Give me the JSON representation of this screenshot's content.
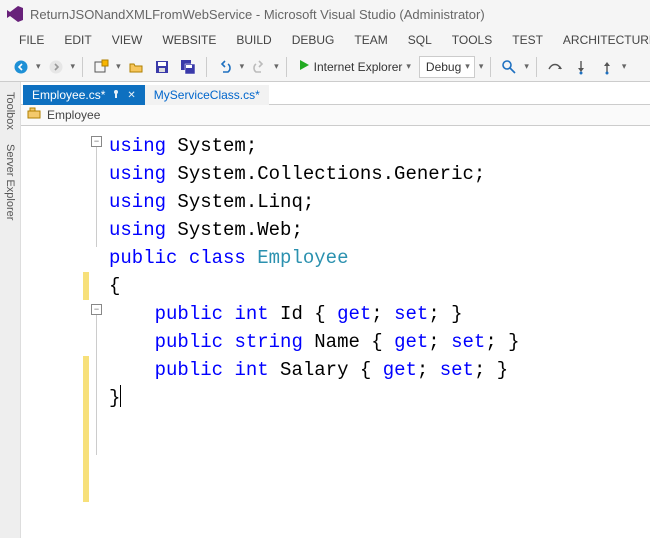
{
  "titlebar": {
    "title": "ReturnJSONandXMLFromWebService - Microsoft Visual Studio (Administrator)"
  },
  "menu": [
    "FILE",
    "EDIT",
    "VIEW",
    "WEBSITE",
    "BUILD",
    "DEBUG",
    "TEAM",
    "SQL",
    "TOOLS",
    "TEST",
    "ARCHITECTURE"
  ],
  "toolbar": {
    "browser": "Internet Explorer",
    "config": "Debug"
  },
  "side_tabs": {
    "toolbox": "Toolbox",
    "server_explorer": "Server Explorer"
  },
  "tabs": [
    {
      "label": "Employee.cs*",
      "active": true
    },
    {
      "label": "MyServiceClass.cs*",
      "active": false
    }
  ],
  "navbar": {
    "type_dropdown": "Employee"
  },
  "code": {
    "lines": [
      {
        "tokens": [
          [
            "kw",
            "using"
          ],
          [
            "pln",
            " "
          ],
          [
            "pln",
            "System;"
          ]
        ]
      },
      {
        "tokens": [
          [
            "kw",
            "using"
          ],
          [
            "pln",
            " "
          ],
          [
            "pln",
            "System.Collections.Generic;"
          ]
        ]
      },
      {
        "tokens": [
          [
            "kw",
            "using"
          ],
          [
            "pln",
            " "
          ],
          [
            "pln",
            "System.Linq;"
          ]
        ]
      },
      {
        "tokens": [
          [
            "kw",
            "using"
          ],
          [
            "pln",
            " "
          ],
          [
            "pln",
            "System.Web;"
          ]
        ]
      },
      {
        "tokens": [
          [
            "pln",
            ""
          ]
        ]
      },
      {
        "tokens": [
          [
            "pln",
            ""
          ]
        ]
      },
      {
        "tokens": [
          [
            "kw",
            "public"
          ],
          [
            "pln",
            " "
          ],
          [
            "kw",
            "class"
          ],
          [
            "pln",
            " "
          ],
          [
            "typ",
            "Employee"
          ]
        ]
      },
      {
        "tokens": [
          [
            "pln",
            "{"
          ]
        ]
      },
      {
        "tokens": [
          [
            "pln",
            "    "
          ],
          [
            "kw",
            "public"
          ],
          [
            "pln",
            " "
          ],
          [
            "kw",
            "int"
          ],
          [
            "pln",
            " Id { "
          ],
          [
            "kw",
            "get"
          ],
          [
            "pln",
            "; "
          ],
          [
            "kw",
            "set"
          ],
          [
            "pln",
            "; }"
          ]
        ]
      },
      {
        "tokens": [
          [
            "pln",
            "    "
          ],
          [
            "kw",
            "public"
          ],
          [
            "pln",
            " "
          ],
          [
            "kw",
            "string"
          ],
          [
            "pln",
            " Name { "
          ],
          [
            "kw",
            "get"
          ],
          [
            "pln",
            "; "
          ],
          [
            "kw",
            "set"
          ],
          [
            "pln",
            "; }"
          ]
        ]
      },
      {
        "tokens": [
          [
            "pln",
            "    "
          ],
          [
            "kw",
            "public"
          ],
          [
            "pln",
            " "
          ],
          [
            "kw",
            "int"
          ],
          [
            "pln",
            " Salary { "
          ],
          [
            "kw",
            "get"
          ],
          [
            "pln",
            "; "
          ],
          [
            "kw",
            "set"
          ],
          [
            "pln",
            "; }"
          ]
        ]
      },
      {
        "tokens": [
          [
            "pln",
            "}"
          ]
        ],
        "caret_after": true
      }
    ]
  }
}
